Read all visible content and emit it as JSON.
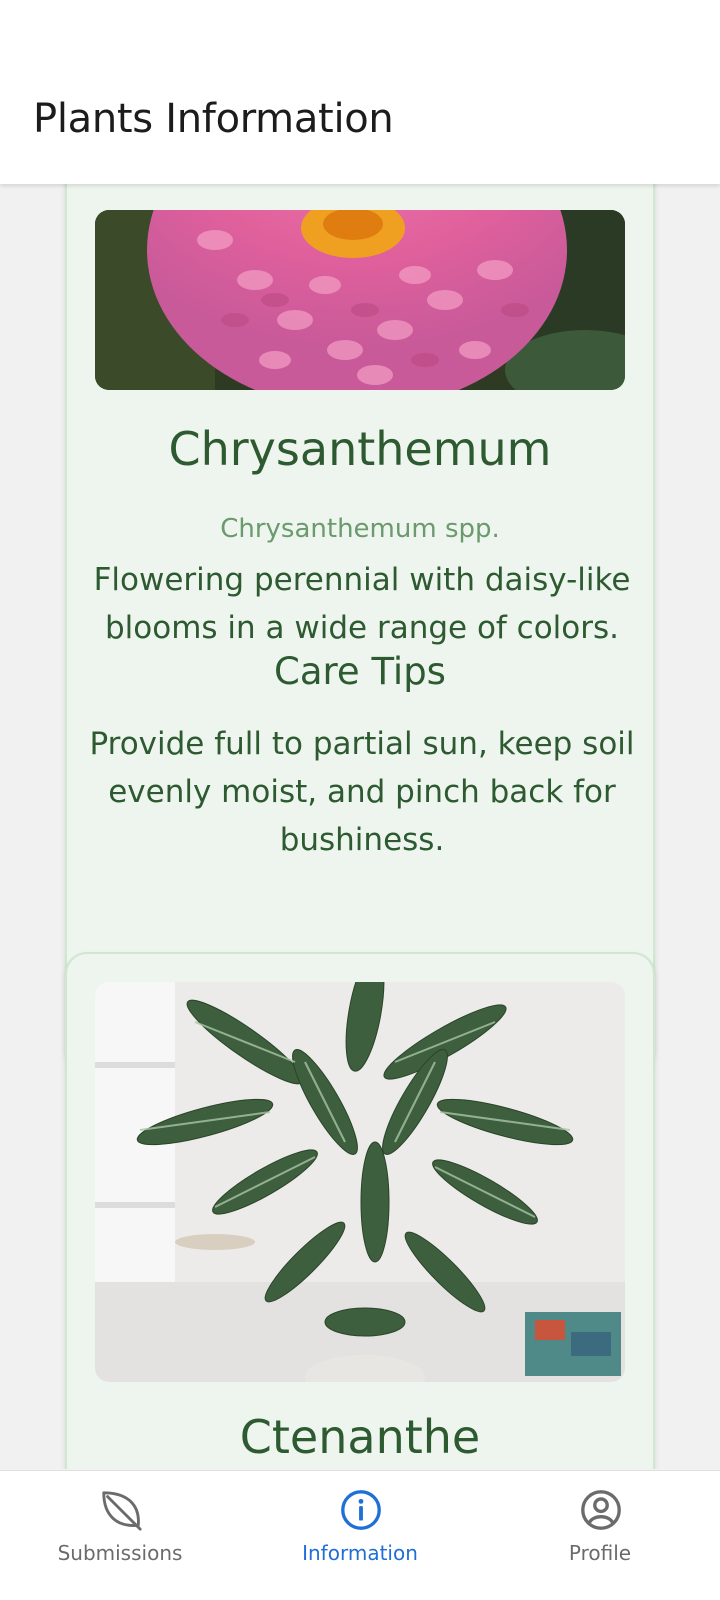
{
  "app_bar": {
    "title": "Plants Information"
  },
  "plants": [
    {
      "name": "Chrysanthemum",
      "scientific_name": "Chrysanthemum spp.",
      "description": "Flowering perennial with daisy-like blooms in a wide range of colors.",
      "care_title": "Care Tips",
      "care_text": "Provide full to partial sun, keep soil evenly moist, and pinch back for bushiness."
    },
    {
      "name": "Ctenanthe"
    }
  ],
  "bottom_nav": {
    "items": [
      {
        "label": "Submissions",
        "icon": "leaf-icon",
        "active": false
      },
      {
        "label": "Information",
        "icon": "info-circle-icon",
        "active": true
      },
      {
        "label": "Profile",
        "icon": "user-circle-icon",
        "active": false
      }
    ]
  },
  "colors": {
    "accent": "#1f6fd6",
    "card_bg": "#eef5ee",
    "card_border": "#cfe6cf",
    "heading_green": "#2d5a30"
  }
}
